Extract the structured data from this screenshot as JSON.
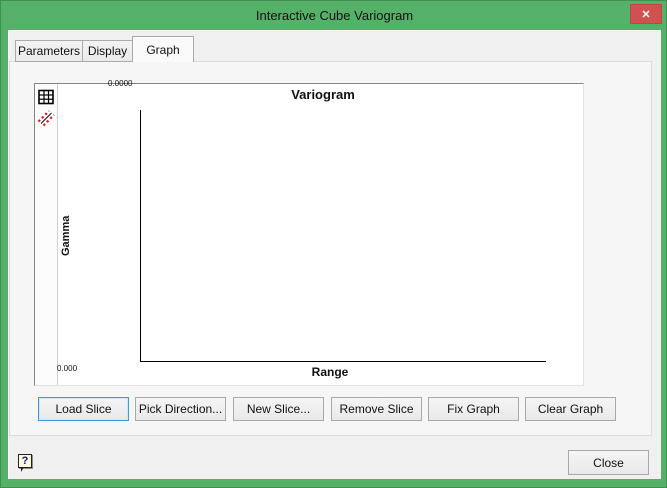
{
  "window": {
    "title": "Interactive Cube Variogram",
    "close_glyph": "✕"
  },
  "tabs": [
    {
      "label": "Parameters",
      "active": false
    },
    {
      "label": "Display",
      "active": false
    },
    {
      "label": "Graph",
      "active": true
    }
  ],
  "graph": {
    "title": "Variogram",
    "xlabel": "Range",
    "ylabel": "Gamma",
    "y_axis_top_label": "0.0000",
    "y_axis_bottom_label": "0.000",
    "toolbar_icons": [
      "grid-icon",
      "hatch-lines-icon"
    ],
    "plot_empty": true
  },
  "slice_buttons": [
    {
      "label": "Load Slice",
      "focused": true
    },
    {
      "label": "Pick Direction...",
      "focused": false
    },
    {
      "label": "New Slice...",
      "focused": false
    },
    {
      "label": "Remove Slice",
      "focused": false
    },
    {
      "label": "Fix Graph",
      "focused": false
    },
    {
      "label": "Clear Graph",
      "focused": false
    }
  ],
  "footer": {
    "help_glyph": "?",
    "close_button": "Close"
  },
  "colors": {
    "titlebar_green": "#55b168",
    "close_red": "#d15050",
    "dialog_bg": "#f0f0f0",
    "page_bg": "#f6f6f6",
    "focus_blue": "#3e9bd8",
    "hatch_red": "#e01b1b"
  }
}
